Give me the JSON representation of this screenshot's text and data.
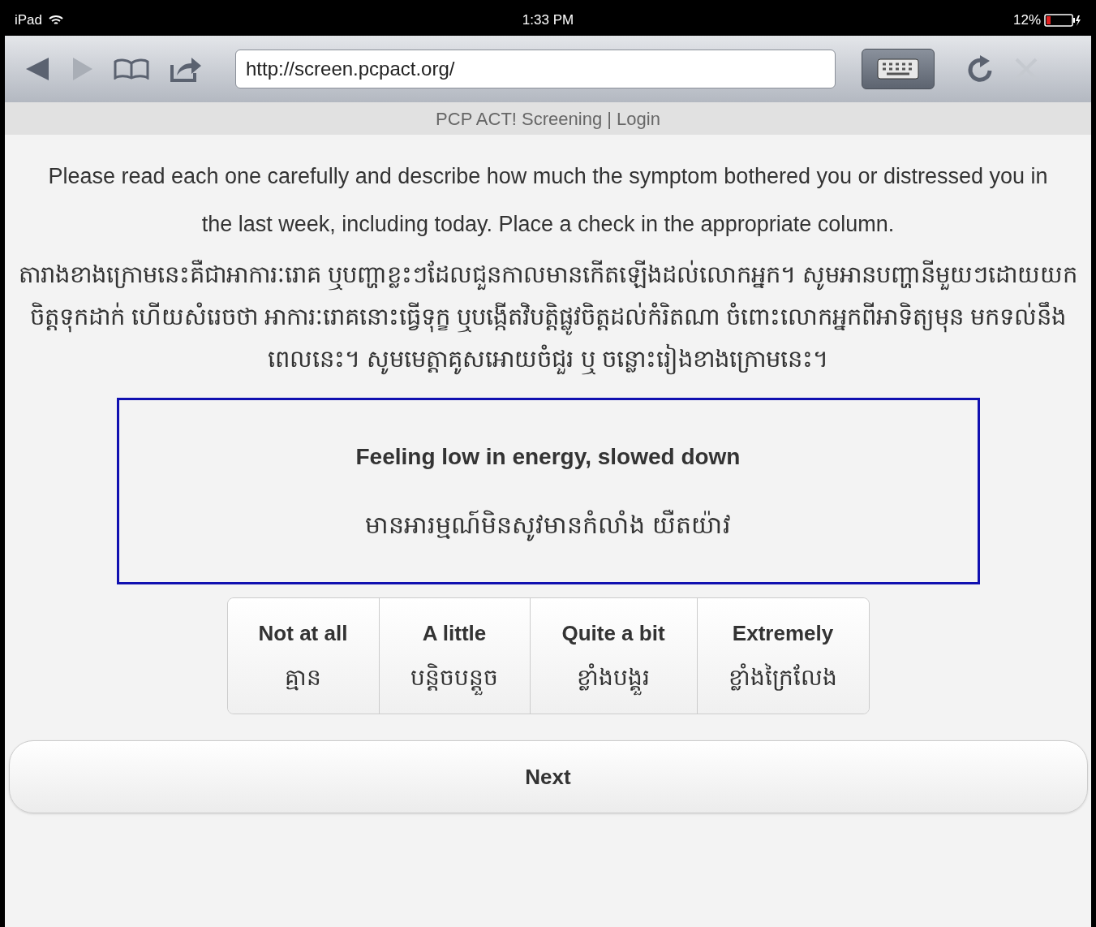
{
  "status_bar": {
    "device": "iPad",
    "time": "1:33 PM",
    "battery": "12%"
  },
  "browser": {
    "url": "http://screen.pcpact.org/",
    "page_title": "PCP ACT! Screening | Login"
  },
  "instructions": {
    "english": "Please read each one carefully and describe how much the symptom bothered you or distressed you in the last week, including today. Place a check in the appropriate column.",
    "khmer": "តារាងខាងក្រោមនេះគឺជាអាការៈរោគ ឬបញ្ហាខ្លះៗដែលជួនកាលមានកើតឡើងដល់លោកអ្នក។ សូមអានបញ្ហានីមួយៗដោយយកចិត្តទុកដាក់ ហើយសំរេចថា អាការៈរោគនោះធ្វើទុក្ខ ឬបង្កើតវិបត្តិផ្លូវចិត្តដល់កំរិតណា ចំពោះលោកអ្នកពីអាទិត្យមុន មកទល់នឹងពេលនេះ។ សូមមេត្តាគូសអោយចំជួរ ឬ ចន្លោះរៀងខាងក្រោមនេះ។"
  },
  "question": {
    "english": "Feeling low in energy, slowed down",
    "khmer": "មានអារម្មណ៍មិនសូវមានកំលាំង យឺតយ៉ាវ"
  },
  "options": [
    {
      "english": "Not at all",
      "khmer": "គ្មាន",
      "selected": false
    },
    {
      "english": "A little",
      "khmer": "បន្តិចបន្តួច",
      "selected": false
    },
    {
      "english": "Quite a bit",
      "khmer": "ខ្លាំងបង្គួរ",
      "selected": false
    },
    {
      "english": "Extremely",
      "khmer": "ខ្លាំងក្រៃលែង",
      "selected": false
    }
  ],
  "next_button": "Next"
}
